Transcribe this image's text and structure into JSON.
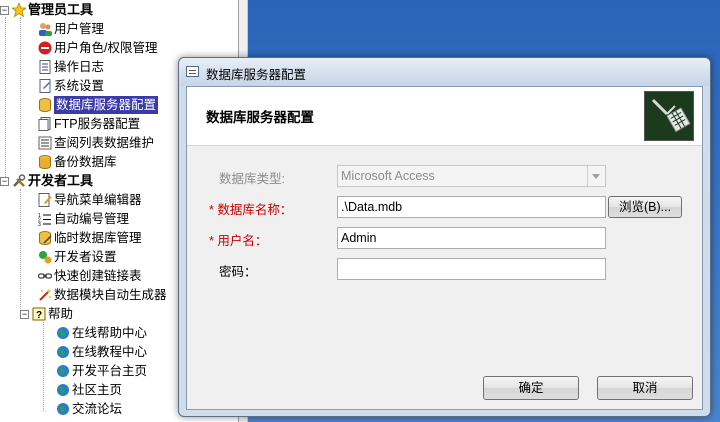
{
  "tree": {
    "groups": [
      {
        "label": "管理员工具",
        "items": [
          "用户管理",
          "用户角色/权限管理",
          "操作日志",
          "系统设置",
          "数据库服务器配置",
          "FTP服务器配置",
          "查阅列表数据维护",
          "备份数据库"
        ],
        "selected_index": 4
      },
      {
        "label": "开发者工具",
        "items": [
          "导航菜单编辑器",
          "自动编号管理",
          "临时数据库管理",
          "开发者设置",
          "快速创建链接表",
          "数据模块自动生成器"
        ],
        "subgroup": {
          "label": "帮助",
          "items": [
            "在线帮助中心",
            "在线教程中心",
            "开发平台主页",
            "社区主页",
            "交流论坛"
          ]
        }
      }
    ]
  },
  "dialog": {
    "title": "数据库服务器配置",
    "header_title": "数据库服务器配置",
    "fields": {
      "db_type_label": "数据库类型:",
      "db_type_value": "Microsoft Access",
      "db_name_label": "* 数据库名称：",
      "db_name_value": ".\\Data.mdb",
      "browse_label": "浏览(B)...",
      "user_label": "* 用户名：",
      "user_value": "Admin",
      "password_label": "密码：",
      "password_value": ""
    },
    "ok_label": "确定",
    "cancel_label": "取消"
  },
  "colors": {
    "selection": "#3a3aa8",
    "required": "#c80000",
    "desktop": "#3a78c8"
  }
}
